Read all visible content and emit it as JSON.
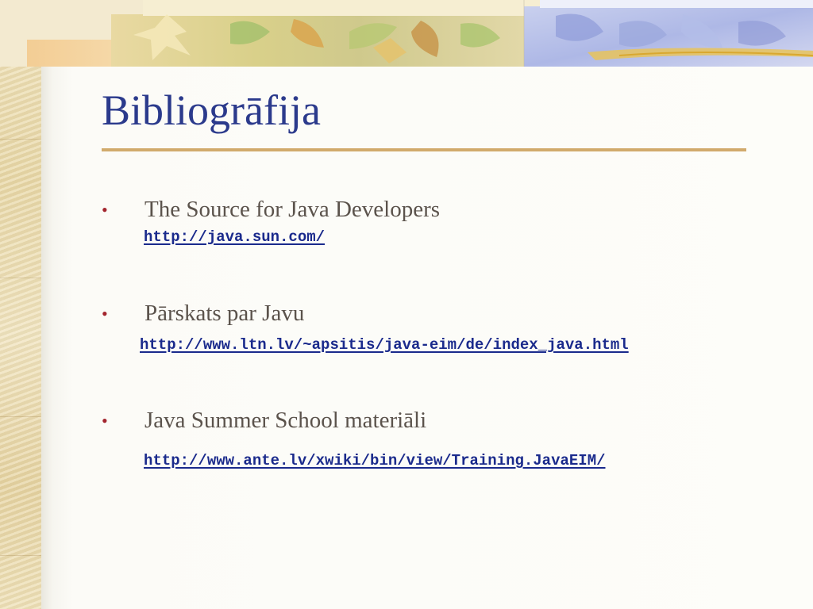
{
  "slide": {
    "title": "Bibliogrāfija",
    "colors": {
      "title": "#2b3a8c",
      "rule": "#d1aa6c",
      "bullet": "#a3252e",
      "text": "#5b534c",
      "link": "#1a2a8c"
    }
  },
  "bullets": [
    {
      "text": "The Source for Java Developers",
      "link": "http://java.sun.com/"
    },
    {
      "text": "Pārskats par Javu",
      "link": "http://www.ltn.lv/~apsitis/java-eim/de/index_java.html"
    },
    {
      "text": "Java Summer School materiāli",
      "link": "http://www.ante.lv/xwiki/bin/view/Training.JavaEIM/"
    }
  ],
  "bullet_marker": "•"
}
